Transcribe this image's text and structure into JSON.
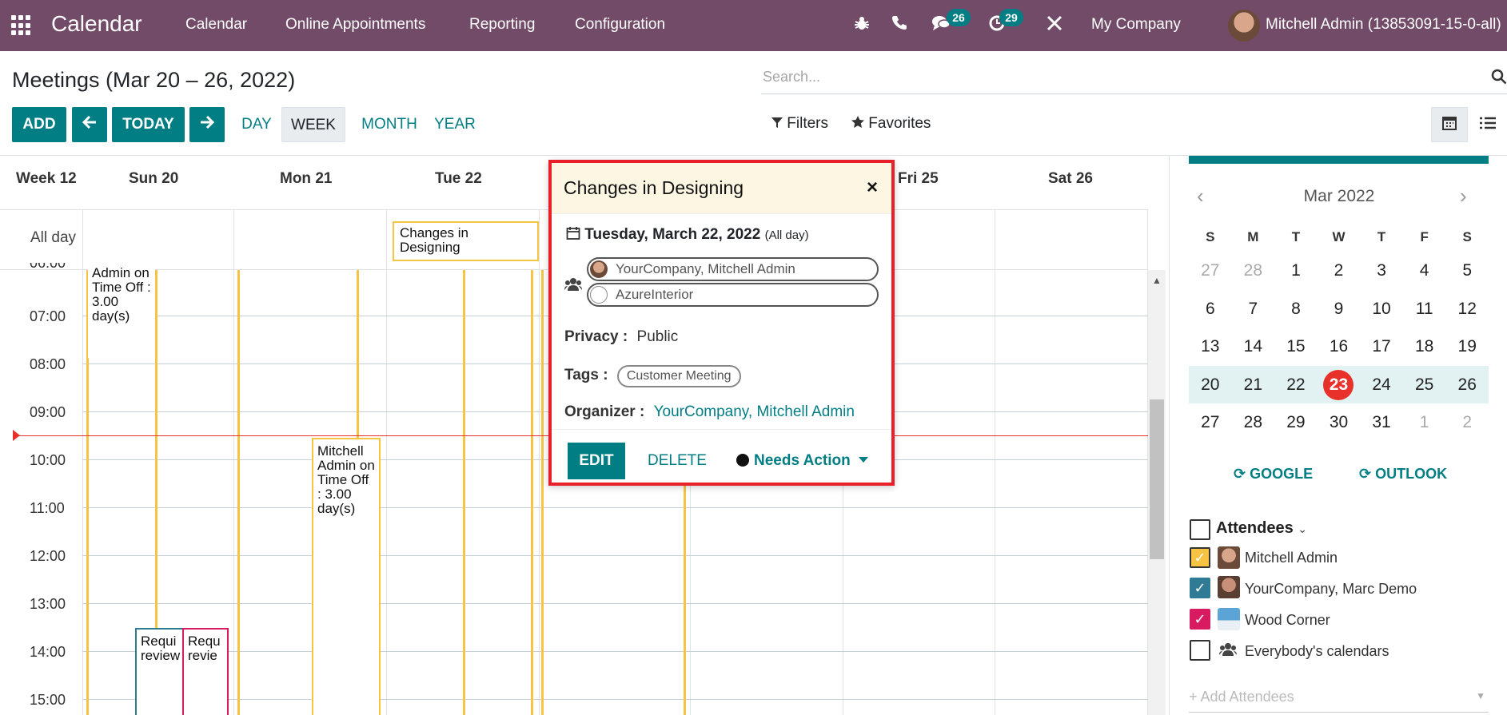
{
  "navbar": {
    "brand": "Calendar",
    "menu": [
      "Calendar",
      "Online Appointments",
      "Reporting",
      "Configuration"
    ],
    "messages_count": "26",
    "activities_count": "29",
    "company": "My Company",
    "user": "Mitchell Admin (13853091-15-0-all)"
  },
  "control": {
    "title": "Meetings (Mar 20 – 26, 2022)",
    "search_placeholder": "Search...",
    "add_label": "ADD",
    "today_label": "TODAY",
    "scales": [
      "DAY",
      "WEEK",
      "MONTH",
      "YEAR"
    ],
    "active_scale": "WEEK",
    "filters_label": "Filters",
    "favorites_label": "Favorites"
  },
  "calendar": {
    "week_label": "Week 12",
    "days": [
      "Sun 20",
      "Mon 21",
      "Tue 22",
      "Fri 25",
      "Sat 26"
    ],
    "allday_label": "All day",
    "hours": [
      "06:00",
      "07:00",
      "08:00",
      "09:00",
      "10:00",
      "11:00",
      "12:00",
      "13:00",
      "14:00",
      "15:00"
    ],
    "allday_event": "Changes in Designing",
    "event_timeoff_1": "Admin on Time Off : 3.00 day(s)",
    "event_timeoff_2": "Mitchell Admin on Time Off : 3.00 day(s)",
    "event_req_1": "Requi review",
    "event_req_2": "Requ revie"
  },
  "popover": {
    "title": "Changes in Designing",
    "date": "Tuesday, March 22, 2022",
    "date_note": "(All day)",
    "attendees": [
      "YourCompany, Mitchell Admin",
      "AzureInterior"
    ],
    "privacy_label": "Privacy :",
    "privacy_value": "Public",
    "tags_label": "Tags :",
    "tag": "Customer Meeting",
    "organizer_label": "Organizer :",
    "organizer_value": "YourCompany, Mitchell Admin",
    "edit_label": "EDIT",
    "delete_label": "DELETE",
    "status_label": "Needs Action"
  },
  "mini_calendar": {
    "month": "Mar 2022",
    "dow": [
      "S",
      "M",
      "T",
      "W",
      "T",
      "F",
      "S"
    ],
    "weeks": [
      [
        "27",
        "28",
        "1",
        "2",
        "3",
        "4",
        "5"
      ],
      [
        "6",
        "7",
        "8",
        "9",
        "10",
        "11",
        "12"
      ],
      [
        "13",
        "14",
        "15",
        "16",
        "17",
        "18",
        "19"
      ],
      [
        "20",
        "21",
        "22",
        "23",
        "24",
        "25",
        "26"
      ],
      [
        "27",
        "28",
        "29",
        "30",
        "31",
        "1",
        "2"
      ]
    ],
    "today": "23"
  },
  "sync": {
    "google": "GOOGLE",
    "outlook": "OUTLOOK"
  },
  "attendees": {
    "title": "Attendees",
    "items": [
      {
        "name": "Mitchell Admin",
        "checked": true,
        "color": "#f6c342"
      },
      {
        "name": "YourCompany, Marc Demo",
        "checked": true,
        "color": "#2f7b96"
      },
      {
        "name": "Wood Corner",
        "checked": true,
        "color": "#d81b60"
      },
      {
        "name": "Everybody's calendars",
        "checked": false,
        "color": "#ffffff"
      }
    ],
    "add_placeholder": "+ Add Attendees"
  },
  "colors": {
    "brand": "#714b67",
    "primary": "#017e84",
    "today": "#e8312b",
    "highlight": "#e8202a"
  }
}
